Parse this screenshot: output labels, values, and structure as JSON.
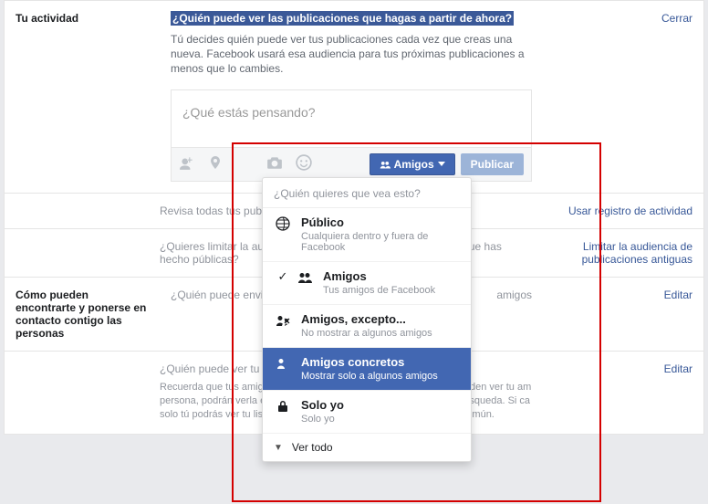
{
  "sections": {
    "activity": {
      "title": "Tu actividad",
      "row0": {
        "question": "¿Quién puede ver las publicaciones que hagas a partir de ahora?",
        "desc": "Tú decides quién puede ver tus publicaciones cada vez que creas una nueva. Facebook usará esa audiencia para tus próximas publicaciones a menos que lo cambies.",
        "close": "Cerrar"
      },
      "composer": {
        "placeholder": "¿Qué estás pensando?",
        "audience_button": "Amigos",
        "publish": "Publicar"
      },
      "row1": {
        "text": "Revisa todas tus publicaciones y los que se te ha etiquetado",
        "action": "Usar registro de actividad"
      },
      "row2": {
        "text": "¿Quieres limitar la audiencia de que has compartido con los o que has hecho públicas?",
        "action": "Limitar la audiencia de publicaciones antiguas"
      }
    },
    "find": {
      "title": "Cómo pueden encontrarte y ponerse en contacto contigo las personas",
      "row0": {
        "question": "¿Quién puede enviarte s",
        "value_suffix": "amigos",
        "action": "Editar"
      },
      "row1": {
        "question": "¿Quién puede ver tu lista",
        "desc": "Recuerda que tus amigos c sus amistades en sus propi personas pueden ver tu am persona, podrán verla en la otros lugares de Facebook, función de búsqueda. Si ca solo tú podrás ver tu lista de biografía. Las demás perso amigos en común.",
        "action": "Editar"
      }
    }
  },
  "dropdown": {
    "title": "¿Quién quieres que vea esto?",
    "items": [
      {
        "key": "public",
        "title": "Público",
        "sub": "Cualquiera dentro y fuera de Facebook"
      },
      {
        "key": "friends",
        "title": "Amigos",
        "sub": "Tus amigos de Facebook"
      },
      {
        "key": "except",
        "title": "Amigos, excepto...",
        "sub": "No mostrar a algunos amigos"
      },
      {
        "key": "specific",
        "title": "Amigos concretos",
        "sub": "Mostrar solo a algunos amigos"
      },
      {
        "key": "onlyme",
        "title": "Solo yo",
        "sub": "Solo yo"
      }
    ],
    "see_all": "Ver todo"
  }
}
